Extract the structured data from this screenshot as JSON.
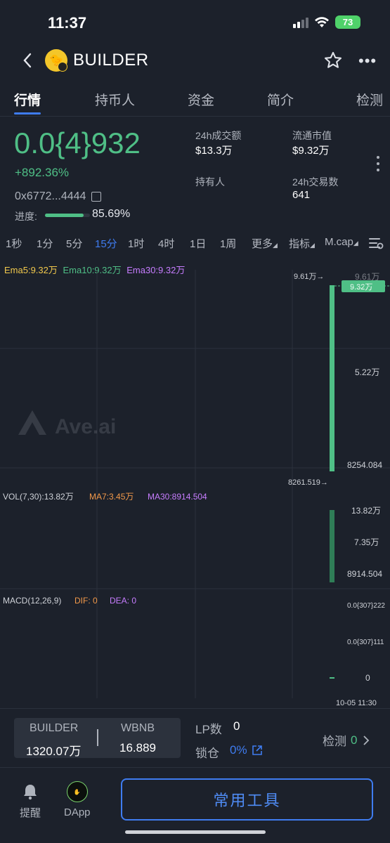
{
  "status_bar": {
    "time": "11:37",
    "battery": "73"
  },
  "header": {
    "title": "BUILDER",
    "avatar_emoji": "🐤"
  },
  "tabs": [
    {
      "label": "行情",
      "active": true
    },
    {
      "label": "持币人",
      "active": false
    },
    {
      "label": "资金",
      "active": false
    },
    {
      "label": "简介",
      "active": false
    },
    {
      "label": "检测",
      "active": false
    }
  ],
  "token": {
    "price": "0.0{4}932",
    "change": "+892.36%",
    "address": "0x6772...4444",
    "progress_label": "进度:",
    "progress_value": "85.69%",
    "progress_fraction": 0.8569
  },
  "stats": {
    "volume_label": "24h成交额",
    "volume_value": "$13.3万",
    "mcap_label": "流通市值",
    "mcap_value": "$9.32万",
    "holders_label": "持有人",
    "holders_value": "",
    "tx_label": "24h交易数",
    "tx_value": "641"
  },
  "intervals": [
    {
      "label": "1秒",
      "active": false
    },
    {
      "label": "1分",
      "active": false
    },
    {
      "label": "5分",
      "active": false
    },
    {
      "label": "15分",
      "active": true
    },
    {
      "label": "1时",
      "active": false
    },
    {
      "label": "4时",
      "active": false
    },
    {
      "label": "1日",
      "active": false
    },
    {
      "label": "1周",
      "active": false
    },
    {
      "label": "更多",
      "active": false
    },
    {
      "label": "指标",
      "active": false
    },
    {
      "label": "M.cap",
      "active": false
    }
  ],
  "chart": {
    "ema5": "Ema5:9.32万",
    "ema10": "Ema10:9.32万",
    "ema30": "Ema30:9.32万",
    "high_marker": "9.61万→",
    "low_marker": "8261.519→",
    "price_badge": "9.32万",
    "price_ticks": [
      "9.61万",
      "5.22万",
      "8254.084"
    ],
    "watermark": "Ave.ai",
    "vol_label": "VOL(7,30):13.82万",
    "vol_ma7": "MA7:3.45万",
    "vol_ma30": "MA30:8914.504",
    "vol_ticks": [
      "13.82万",
      "7.35万",
      "8914.504"
    ],
    "macd_label": "MACD(12,26,9)",
    "macd_dif": "DIF: 0",
    "macd_dea": "DEA: 0",
    "macd_ticks": [
      "0.0{307}222",
      "0.0{307}111",
      "0"
    ],
    "time_label": "10-05 11:30",
    "colors": {
      "up": "#4fbf86",
      "ema5": "#f2c94c",
      "ema10": "#4fbf86",
      "ema30": "#c77dff",
      "ma7": "#f2994a",
      "ma30": "#c77dff"
    }
  },
  "pair": {
    "base": "BUILDER",
    "base_amount": "1320.07万",
    "quote": "WBNB",
    "quote_amount": "16.889",
    "lp_label": "LP数",
    "lp_value": "0",
    "lock_label": "锁仓",
    "lock_value": "0%",
    "detect_label": "检测",
    "detect_value": "0"
  },
  "bottom_nav": {
    "alert_label": "提醒",
    "dapp_label": "DApp",
    "tools_label": "常用工具"
  }
}
